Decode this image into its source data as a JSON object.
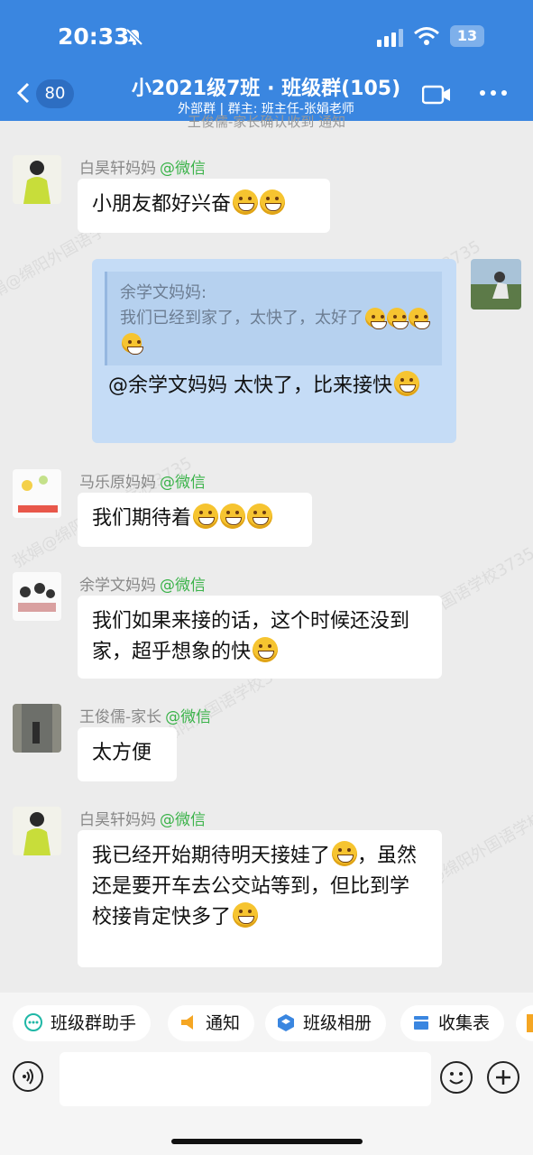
{
  "status_bar": {
    "time": "20:33",
    "battery": "13"
  },
  "header": {
    "unread_count": "80",
    "title": "小2021级7班 · 班级群(105)",
    "subtitle": "外部群 | 群主: 班主任-张娟老师"
  },
  "notice_text": "王俊儒-家长确认收到 通知",
  "messages": [
    {
      "sender": "白昊轩妈妈",
      "tag": "@微信",
      "text": "小朋友都好兴奋"
    },
    {
      "sender": "马乐原妈妈",
      "tag": "@微信",
      "text": "我们期待着"
    },
    {
      "sender": "余学文妈妈",
      "tag": "@微信",
      "text": "我们如果来接的话，这个时候还没到家，超乎想象的快"
    },
    {
      "sender": "王俊儒-家长",
      "tag": "@微信",
      "text": "太方便"
    },
    {
      "sender": "白昊轩妈妈",
      "tag": "@微信",
      "text": "我已经开始期待明天接娃了",
      "text2": "，虽然还是要开车去公交站等到，但比到学校接肯定快多了"
    }
  ],
  "my_message": {
    "quote_sender": "余学文妈妈:",
    "quote_text": "我们已经到家了，太快了，太好了",
    "text": "@余学文妈妈 太快了，比来接快"
  },
  "toolbar": {
    "items": [
      "班级群助手",
      "通知",
      "班级相册",
      "收集表"
    ]
  },
  "watermark": "张娟@绵阳外国语学校3735"
}
